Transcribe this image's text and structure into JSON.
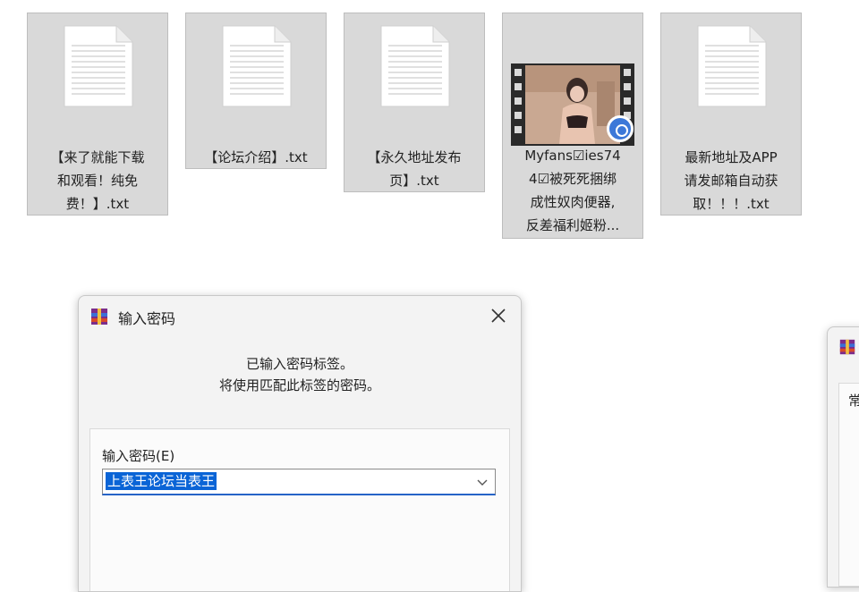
{
  "files": [
    {
      "name": "【来了就能下载和观看！纯免费！】.txt",
      "lines": [
        "【来了就能下载",
        "和观看！纯免",
        "费！】.txt"
      ],
      "icon": "text-file-icon"
    },
    {
      "name": "【论坛介绍】.txt",
      "lines": [
        "【论坛介绍】.txt"
      ],
      "icon": "text-file-icon"
    },
    {
      "name": "【永久地址发布页】.txt",
      "lines": [
        "【永久地址发布",
        "页】.txt"
      ],
      "icon": "text-file-icon"
    },
    {
      "name": "Myfans☑ies744☑被死死捆绑成性奴肉便器，反差福利姬粉...",
      "lines": [
        "Myfans☑ies74",
        "4☑被死死捆绑",
        "成性奴肉便器,",
        "反差福利姬粉..."
      ],
      "icon": "video-file-icon"
    },
    {
      "name": "最新地址及APP请发邮箱自动获取！！！.txt",
      "lines": [
        "最新地址及APP",
        "请发邮箱自动获",
        "取！！！.txt"
      ],
      "icon": "text-file-icon"
    }
  ],
  "dialog": {
    "title": "输入密码",
    "message_line1": "已输入密码标签。",
    "message_line2": "将使用匹配此标签的密码。",
    "field_label": "输入密码(E)",
    "password_value": "上表王论坛当表王",
    "icon": "winrar-icon",
    "close_icon": "close-icon"
  },
  "partial_window": {
    "tab_label": "常",
    "icon": "winrar-icon"
  },
  "colors": {
    "tile_bg": "#d9d9d9",
    "selection": "#0a64d6",
    "badge": "#3c78d8"
  }
}
